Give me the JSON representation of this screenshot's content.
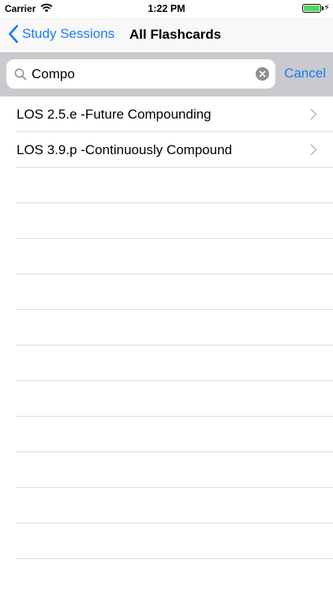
{
  "status_bar": {
    "carrier": "Carrier",
    "time": "1:22 PM",
    "battery_level": 1.0
  },
  "nav_bar": {
    "back_label": "Study Sessions",
    "title": "All Flashcards"
  },
  "search": {
    "value": "Compo",
    "cancel_label": "Cancel"
  },
  "results": [
    {
      "label": "LOS 2.5.e -Future Compounding"
    },
    {
      "label": "LOS 3.9.p -Continuously Compound"
    }
  ],
  "colors": {
    "accent": "#1a7cf5",
    "search_bar_bg": "#c9c9ce",
    "separator": "#dcdce0"
  }
}
